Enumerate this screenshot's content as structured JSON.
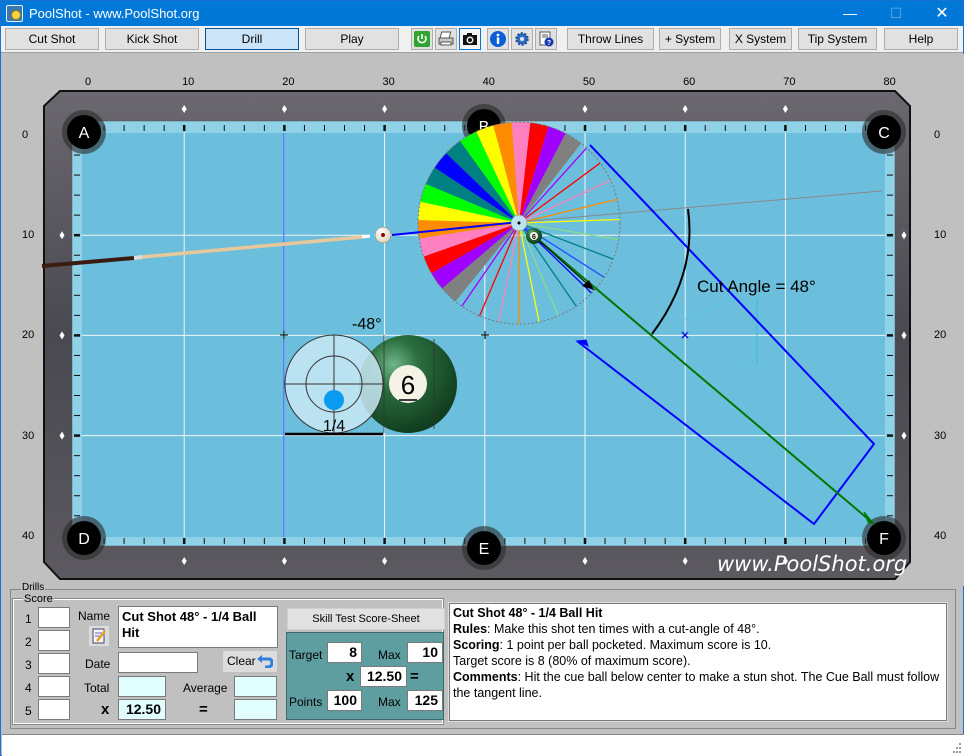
{
  "window": {
    "title": "PoolShot - www.PoolShot.org",
    "minimize": "—",
    "maximize": "☐",
    "close": "✕"
  },
  "toolbar": {
    "buttons": [
      {
        "label": "Cut Shot",
        "active": false
      },
      {
        "label": "Kick Shot",
        "active": false
      },
      {
        "label": "Drill",
        "active": true
      },
      {
        "label": "Play",
        "active": false
      }
    ],
    "icons": [
      "power-icon",
      "print-icon",
      "camera-icon",
      "info-icon",
      "settings-gear-icon",
      "help-document-icon"
    ],
    "right_buttons": [
      {
        "label": "Throw Lines"
      },
      {
        "label": "+ System"
      },
      {
        "label": "X System"
      },
      {
        "label": "Tip System"
      },
      {
        "label": "Help"
      }
    ]
  },
  "table": {
    "x_axis_labels": [
      "0",
      "10",
      "20",
      "30",
      "40",
      "50",
      "60",
      "70",
      "80"
    ],
    "y_axis_labels": [
      "0",
      "10",
      "20",
      "30",
      "40"
    ],
    "pockets": [
      "A",
      "B",
      "C",
      "D",
      "E",
      "F"
    ],
    "object_ball_number": "6",
    "cut_angle_label": "Cut Angle = 48°",
    "aim_angle_label": "-48°",
    "ball_fraction_label": "1/4",
    "watermark": "www.PoolShot.org",
    "colors": {
      "felt": "#6cbfdc",
      "rail": "#5a5a5a",
      "cushion": "#8fd1e6",
      "aim_line": "#0000ff",
      "object_path": "#007700",
      "ghost_ball_fill": "#bfe3f0",
      "contact_dot": "#0a9cf0"
    },
    "fan_colors": [
      "#808080",
      "#a000ff",
      "#ff0000",
      "#ff80c0",
      "#ff8c00",
      "#ffff00",
      "#00ff00",
      "#008080",
      "#0000ff",
      "#008080",
      "#00ff00",
      "#ffff00",
      "#ff8c00",
      "#ff80c0",
      "#ff0000",
      "#a000ff",
      "#808080"
    ]
  },
  "drills": {
    "legend": "Drills",
    "score_legend": "Score",
    "rows": [
      "1",
      "2",
      "3",
      "4",
      "5"
    ],
    "name_label": "Name",
    "name_value": "Cut Shot 48° - 1/4 Ball Hit",
    "date_label": "Date",
    "date_value": "",
    "clear_label": "Clear",
    "total_label": "Total",
    "average_label": "Average",
    "multiplier_symbol": "x",
    "multiplier_value": "12.50",
    "equals_symbol": "=",
    "skill_test_label": "Skill Test Score-Sheet",
    "target": {
      "target_label": "Target",
      "target_value": "8",
      "max_label": "Max",
      "max_value": "10",
      "x_symbol": "x",
      "multiplier": "12.50",
      "eq_symbol": "=",
      "points_label": "Points",
      "points_value": "100",
      "points_max_label": "Max",
      "points_max_value": "125"
    },
    "notes": {
      "title": "Cut Shot 48° - 1/4 Ball Hit",
      "rules_label": "Rules",
      "rules_text": ": Make this shot ten times with a cut-angle of 48°.",
      "scoring_label": "Scoring",
      "scoring_text": ": 1 point per ball pocketed. Maximum score is 10.",
      "target_text": "Target score is 8 (80% of maximum score).",
      "comments_label": "Comments",
      "comments_text": ": Hit the cue ball below center to make a stun shot. The Cue Ball must follow the tangent line."
    }
  }
}
